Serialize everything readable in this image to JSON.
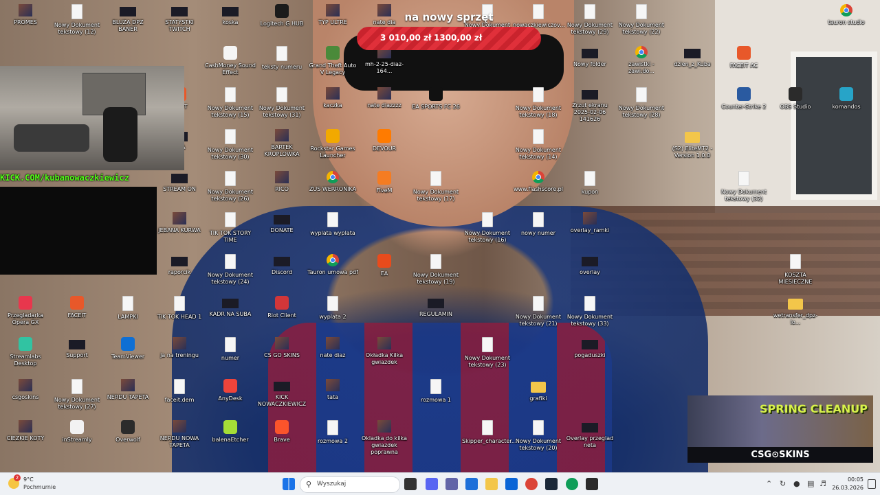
{
  "desktop": {
    "icons": [
      {
        "label": "PROMES",
        "type": "img"
      },
      {
        "label": "Nowy Dokument tekstowy (12)",
        "type": "doc"
      },
      {
        "label": "BLUZA DPZ BANER",
        "type": "dark"
      },
      {
        "label": "STATYSTKI TWITCH",
        "type": "dark"
      },
      {
        "label": "koska",
        "type": "dark"
      },
      {
        "label": "Logitech G HUB",
        "type": "app",
        "color": "#1b1b1b"
      },
      {
        "label": "TYP ULTRE",
        "type": "img"
      },
      {
        "label": "nate dia",
        "type": "img"
      },
      {
        "label": "Nowy Dokument tekstowy (13)",
        "type": "doc"
      },
      {
        "label": "nowaczkiewiczov...",
        "type": "doc"
      },
      {
        "label": "Nowy Dokument tekstowy (29)",
        "type": "doc"
      },
      {
        "label": "Nowy Dokument tekstowy (22)",
        "type": "doc"
      },
      {
        "label": "tauron studio",
        "type": "chrome"
      },
      {
        "label": "CashMoney Sound Effect",
        "type": "app",
        "color": "#f5f5f5"
      },
      {
        "label": "teksty numeru",
        "type": "doc"
      },
      {
        "label": "Grand Theft Auto V Legacy",
        "type": "app",
        "color": "#4a8a3a"
      },
      {
        "label": "mh-2-25-diaz-164...",
        "type": "img"
      },
      {
        "label": "Nowy folder",
        "type": "dark"
      },
      {
        "label": "zawistki - zawi.do...",
        "type": "chrome"
      },
      {
        "label": "dzien_z_Kuba",
        "type": "dark"
      },
      {
        "label": "FACEIT AC",
        "type": "app",
        "color": "#e8582a"
      },
      {
        "label": "ACEIT",
        "type": "app",
        "color": "#e8582a"
      },
      {
        "label": "Nowy Dokument tekstowy (15)",
        "type": "doc"
      },
      {
        "label": "Nowy Dokument tekstowy (31)",
        "type": "doc"
      },
      {
        "label": "kaczka",
        "type": "img"
      },
      {
        "label": "nate diazzzz",
        "type": "img"
      },
      {
        "label": "EA SPORTS FC 26",
        "type": "app",
        "color": "#111"
      },
      {
        "label": "Nowy Dokument tekstowy (18)",
        "type": "doc"
      },
      {
        "label": "Zrzut ekranu 2025-02-06 141626",
        "type": "dark"
      },
      {
        "label": "Nowy Dokument tekstowy (28)",
        "type": "doc"
      },
      {
        "label": "Counter-Strike 2",
        "type": "app",
        "color": "#2a5aa0"
      },
      {
        "label": "OBS Studio",
        "type": "app",
        "color": "#2b2b2b"
      },
      {
        "label": "komandos",
        "type": "app",
        "color": "#27a4c8"
      },
      {
        "label": "NBA",
        "type": "dark"
      },
      {
        "label": "Nowy Dokument tekstowy (30)",
        "type": "doc"
      },
      {
        "label": "BARTEK KROPLOWKA",
        "type": "img"
      },
      {
        "label": "Rockstar Games Launcher",
        "type": "app",
        "color": "#f2a900"
      },
      {
        "label": "DEVOUR",
        "type": "app",
        "color": "#ff7b00"
      },
      {
        "label": "Nowy Dokument tekstowy (14)",
        "type": "doc"
      },
      {
        "label": "(S2) EliteMT2 - Version 1.0.0",
        "type": "folder"
      },
      {
        "label": "STREAM ON",
        "type": "dark"
      },
      {
        "label": "Nowy Dokument tekstowy (26)",
        "type": "doc"
      },
      {
        "label": "RICO",
        "type": "img"
      },
      {
        "label": "ZUS WERRONIKA",
        "type": "chrome"
      },
      {
        "label": "FiveM",
        "type": "app",
        "color": "#f57c22"
      },
      {
        "label": "Nowy Dokument tekstowy (17)",
        "type": "doc"
      },
      {
        "label": "www.flashscore.pl",
        "type": "chrome"
      },
      {
        "label": "kupon",
        "type": "doc"
      },
      {
        "label": "Nowy Dokument tekstowy (32)",
        "type": "doc"
      },
      {
        "label": "JEBANA KURWA",
        "type": "img"
      },
      {
        "label": "TIK TOK STORY TIME",
        "type": "doc"
      },
      {
        "label": "DONATE",
        "type": "dark"
      },
      {
        "label": "wyplata wyplata",
        "type": "doc"
      },
      {
        "label": "Nowy Dokument tekstowy (16)",
        "type": "doc"
      },
      {
        "label": "nowy numer",
        "type": "doc"
      },
      {
        "label": "overlay_ramki",
        "type": "img"
      },
      {
        "label": "raporcik",
        "type": "dark"
      },
      {
        "label": "Nowy Dokument tekstowy (24)",
        "type": "doc"
      },
      {
        "label": "Discord",
        "type": "dark"
      },
      {
        "label": "Tauron umowa pdf",
        "type": "chrome"
      },
      {
        "label": "EA",
        "type": "app",
        "color": "#e84b1c"
      },
      {
        "label": "Nowy Dokument tekstowy (19)",
        "type": "doc"
      },
      {
        "label": "overlay",
        "type": "dark"
      },
      {
        "label": "KOSZTA MIESIECZNE",
        "type": "doc"
      },
      {
        "label": "Przegladarka Opera GX",
        "type": "app",
        "color": "#e8374d"
      },
      {
        "label": "FACEIT",
        "type": "app",
        "color": "#e8582a"
      },
      {
        "label": "LAMPKI",
        "type": "doc"
      },
      {
        "label": "TIK TOK HEAD 1",
        "type": "doc"
      },
      {
        "label": "KADR NA SUBA",
        "type": "dark"
      },
      {
        "label": "Riot Client",
        "type": "app",
        "color": "#d13639"
      },
      {
        "label": "wyplata 2",
        "type": "doc"
      },
      {
        "label": "REGULAMIN",
        "type": "dark"
      },
      {
        "label": "Nowy Dokument tekstowy (21)",
        "type": "doc"
      },
      {
        "label": "Nowy Dokument tekstowy (33)",
        "type": "doc"
      },
      {
        "label": "wetransfer_dpz-lo...",
        "type": "folder"
      },
      {
        "label": "Streamlabs Desktop",
        "type": "app",
        "color": "#31c3a2"
      },
      {
        "label": "Support",
        "type": "dark"
      },
      {
        "label": "TeamViewer",
        "type": "app",
        "color": "#0e6fd4"
      },
      {
        "label": "ja na treningu",
        "type": "img"
      },
      {
        "label": "numer",
        "type": "doc"
      },
      {
        "label": "CS GO SKINS",
        "type": "img"
      },
      {
        "label": "nate diaz",
        "type": "img"
      },
      {
        "label": "Okładka Kilka gwiazdek",
        "type": "img"
      },
      {
        "label": "Nowy Dokument tekstowy (23)",
        "type": "doc"
      },
      {
        "label": "pogaduszki",
        "type": "dark"
      },
      {
        "label": "csgoskins",
        "type": "img"
      },
      {
        "label": "Nowy Dokument tekstowy (27)",
        "type": "doc"
      },
      {
        "label": "NERDU TAPETA",
        "type": "img"
      },
      {
        "label": "faceit.dem",
        "type": "doc"
      },
      {
        "label": "AnyDesk",
        "type": "app",
        "color": "#ef443b"
      },
      {
        "label": "KICK NOWACZKIEWICZ",
        "type": "dark"
      },
      {
        "label": "tata",
        "type": "img"
      },
      {
        "label": "rozmowa 1",
        "type": "doc"
      },
      {
        "label": "grafiki",
        "type": "folder"
      },
      {
        "label": "CIEZKIE KOTY",
        "type": "img"
      },
      {
        "label": "inStreamly",
        "type": "app",
        "color": "#f2f2f2"
      },
      {
        "label": "Overwolf",
        "type": "app",
        "color": "#2b2b2b"
      },
      {
        "label": "NERDU NOWA TAPETA",
        "type": "img"
      },
      {
        "label": "balenaEtcher",
        "type": "app",
        "color": "#a5de37"
      },
      {
        "label": "Brave",
        "type": "app",
        "color": "#fb542b"
      },
      {
        "label": "rozmowa 2",
        "type": "doc"
      },
      {
        "label": "Okladka do kilka gwiazdek poprawna",
        "type": "img"
      },
      {
        "label": "Skipper_character...",
        "type": "doc"
      },
      {
        "label": "Nowy Dokument tekstowy (20)",
        "type": "doc"
      },
      {
        "label": "Overlay przeglad neta",
        "type": "dark"
      }
    ]
  },
  "donation": {
    "title": "na nowy sprzęt",
    "current": "3 010,00 zł",
    "goal": "1300,00 zł"
  },
  "stream": {
    "kick_url": "KICK.COM/kubanowaczkiewicz"
  },
  "promo": {
    "headline": "SPRING CLEANUP",
    "brand": "CSG⊙SKINS"
  },
  "taskbar": {
    "weather_temp": "9°C",
    "weather_cond": "Pochmurnie",
    "weather_badge": "2",
    "search_placeholder": "Wyszukaj",
    "time": "00:05",
    "date": "26.03.2026",
    "apps": [
      {
        "name": "task-view",
        "color": "#333333"
      },
      {
        "name": "discord",
        "color": "#5865f2"
      },
      {
        "name": "teams",
        "color": "#6264a7"
      },
      {
        "name": "store",
        "color": "#1e6fd9"
      },
      {
        "name": "explorer",
        "color": "#f3c64a"
      },
      {
        "name": "outlook",
        "color": "#0a64d6"
      },
      {
        "name": "chrome",
        "color": "#db4437"
      },
      {
        "name": "steam",
        "color": "#1b2838"
      },
      {
        "name": "chrome-2",
        "color": "#0f9d58"
      },
      {
        "name": "obs",
        "color": "#2b2b2b"
      }
    ]
  }
}
